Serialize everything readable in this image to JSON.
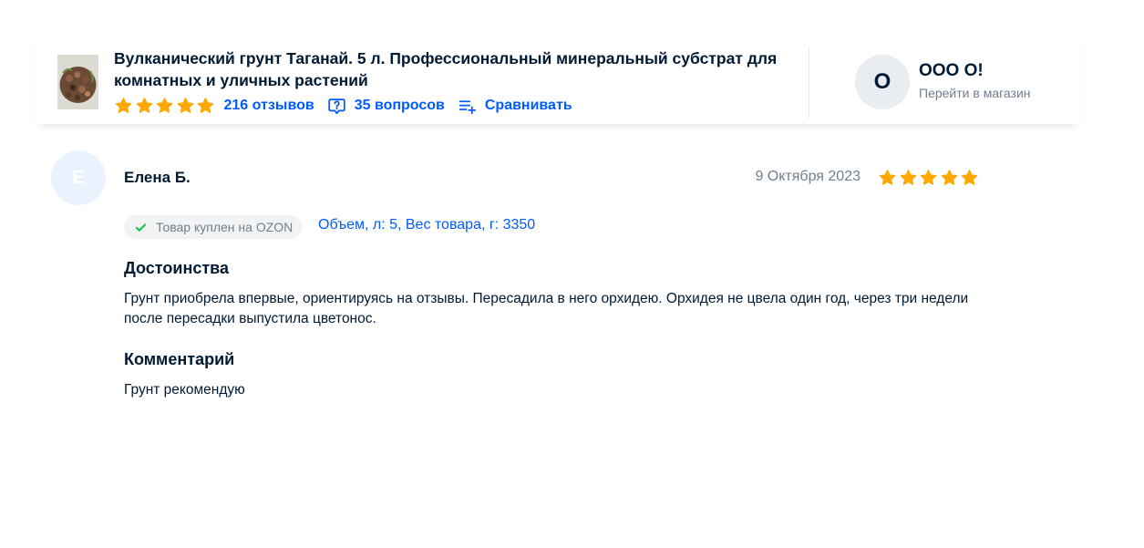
{
  "product": {
    "title": "Вулканический грунт Таганай. 5 л. Профессиональный минеральный субстрат для комнатных и уличных растений",
    "rating": 5,
    "reviews_label": "216 отзывов",
    "questions_label": "35 вопросов",
    "compare_label": "Сравнивать",
    "thumbnail_icon": "product-thumbnail"
  },
  "store": {
    "avatar_letter": "О",
    "name": "ООО О!",
    "link_label": "Перейти в магазин"
  },
  "review": {
    "avatar_letter": "Е",
    "author": "Елена Б.",
    "date": "9 Октября 2023",
    "rating": 5,
    "badge_label": "Товар куплен на OZON",
    "variant": "Объем, л: 5, Вес товара, г: 3350",
    "pros_title": "Достоинства",
    "pros_text": "Грунт приобрела впервые, ориентируясь на отзывы. Пересадила в него орхидею. Орхидея не цвела один год, через три недели после пересадки выпустила цветонос.",
    "comment_title": "Комментарий",
    "comment_text": "Грунт рекомендую"
  },
  "colors": {
    "star": "#ffa800",
    "link": "#005bff",
    "text": "#001a34",
    "muted": "#707f8d",
    "badge_check": "#10c44c"
  }
}
